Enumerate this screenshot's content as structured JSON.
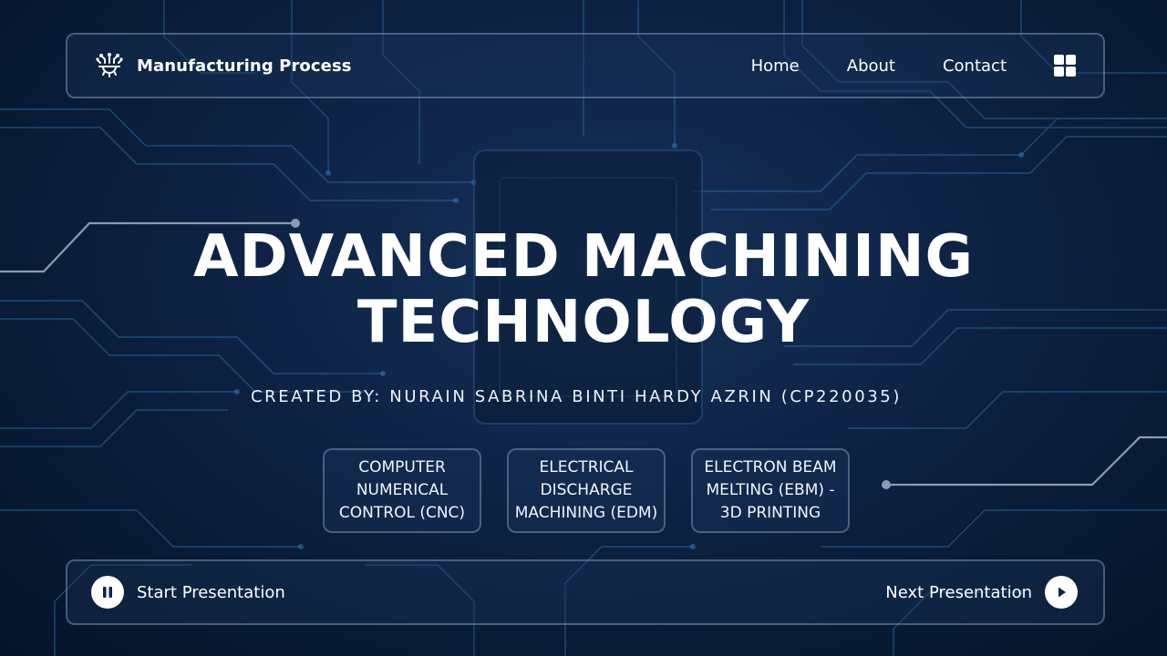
{
  "header": {
    "brand_icon": "gear-circuit-icon",
    "brand_title": "Manufacturing Process",
    "nav": [
      {
        "label": "Home"
      },
      {
        "label": "About"
      },
      {
        "label": "Contact"
      }
    ],
    "menu_icon": "grid-menu-icon"
  },
  "hero": {
    "title_line1": "ADVANCED MACHINING",
    "title_line2": "TECHNOLOGY",
    "credit": "CREATED BY: NURAIN SABRINA BINTI HARDY AZRIN (CP220035)"
  },
  "topics": [
    {
      "line1": "COMPUTER",
      "line2": "NUMERICAL",
      "line3": "CONTROL (CNC)"
    },
    {
      "line1": "ELECTRICAL",
      "line2": "DISCHARGE",
      "line3": "MACHINING (EDM)"
    },
    {
      "line1": "ELECTRON BEAM",
      "line2": "MELTING (EBM) -",
      "line3": "3D PRINTING"
    }
  ],
  "footer": {
    "start_label": "Start Presentation",
    "start_icon": "pause-icon",
    "next_label": "Next Presentation",
    "next_icon": "play-icon"
  },
  "colors": {
    "background": "#0e2346",
    "circuit_trace": "#2f6fa8",
    "accent_line": "#8d9bb0",
    "text": "#ffffff"
  }
}
